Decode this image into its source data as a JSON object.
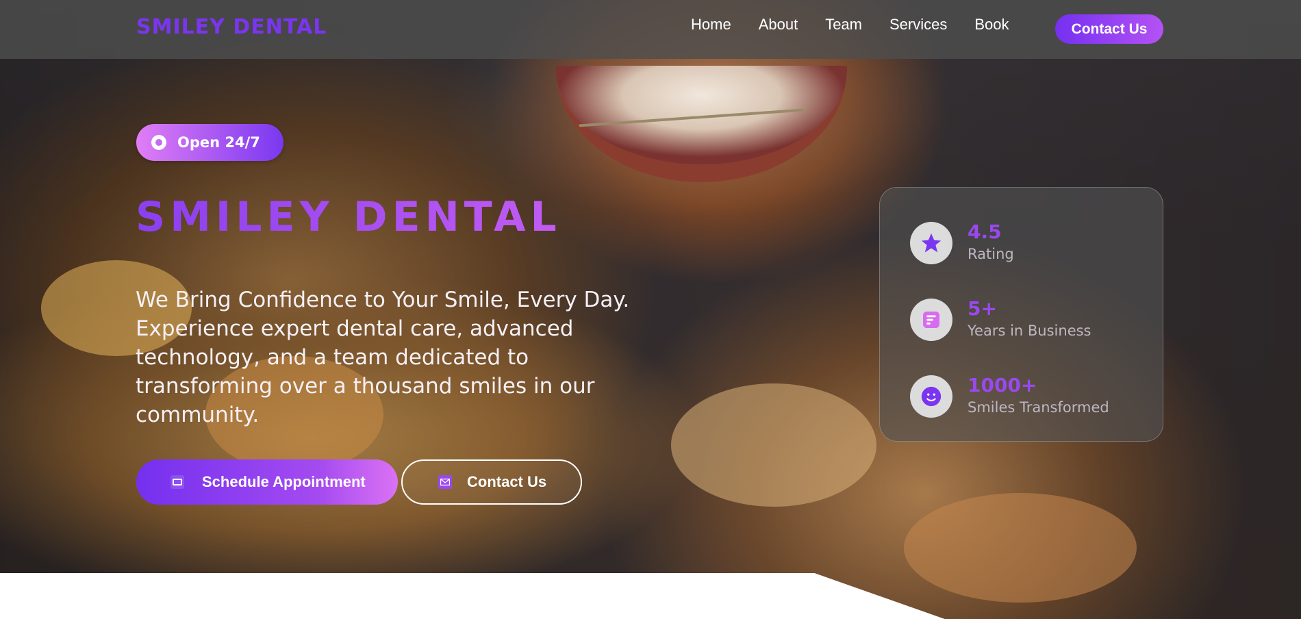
{
  "header": {
    "brand": "SMILEY DENTAL",
    "nav": [
      {
        "label": "Home"
      },
      {
        "label": "About"
      },
      {
        "label": "Team"
      },
      {
        "label": "Services"
      },
      {
        "label": "Book"
      }
    ],
    "cta_label": "Contact Us"
  },
  "hero": {
    "badge_label": "Open 24/7",
    "title": "SMILEY DENTAL",
    "description": "We Bring Confidence to Your Smile, Every Day. Experience expert dental care, advanced technology, and a team dedicated to transforming over a thousand smiles in our community.",
    "primary_button": "Schedule Appointment",
    "secondary_button": "Contact Us"
  },
  "stats": [
    {
      "value": "4.5",
      "label": "Rating",
      "icon": "star-icon"
    },
    {
      "value": "5+",
      "label": "Years in Business",
      "icon": "document-icon"
    },
    {
      "value": "1000+",
      "label": "Smiles Transformed",
      "icon": "smiley-icon"
    }
  ],
  "colors": {
    "accent": "#7b35f0",
    "accent_light": "#c25cf2",
    "stat_value": "#9a48ef"
  }
}
